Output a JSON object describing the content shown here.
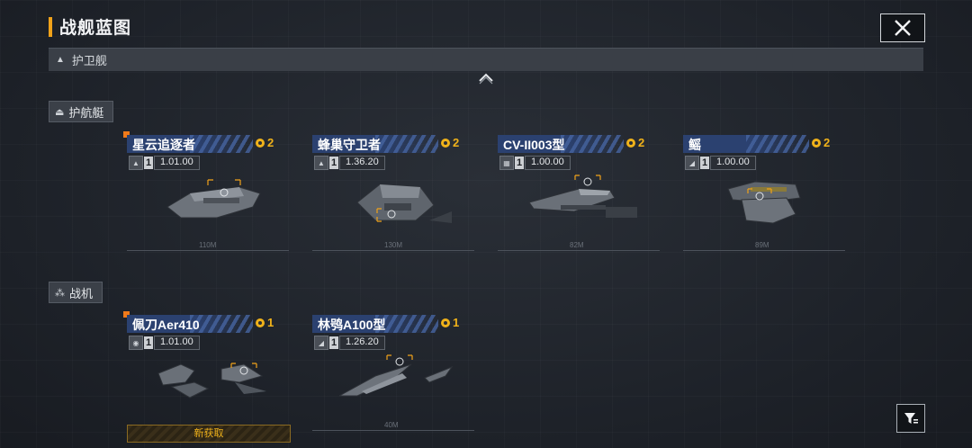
{
  "header": {
    "title": "战舰蓝图"
  },
  "category": {
    "label": "护卫舰"
  },
  "sections": [
    {
      "label": "护航艇"
    },
    {
      "label": "战机"
    }
  ],
  "escorts": [
    {
      "name": "星云追逐者",
      "count": "2",
      "level": "1",
      "value": "1.01.00",
      "dim": "110M"
    },
    {
      "name": "蜂巢守卫者",
      "count": "2",
      "level": "1",
      "value": "1.36.20",
      "dim": "130M"
    },
    {
      "name": "CV-II003型",
      "count": "2",
      "level": "1",
      "value": "1.00.00",
      "dim": "82M"
    },
    {
      "name": "鳐",
      "count": "2",
      "level": "1",
      "value": "1.00.00",
      "dim": "89M"
    }
  ],
  "fighters": [
    {
      "name": "佩刀Aer410",
      "count": "1",
      "level": "1",
      "value": "1.01.00",
      "status": "新获取"
    },
    {
      "name": "林鸮A100型",
      "count": "1",
      "level": "1",
      "value": "1.26.20",
      "dim": "40M"
    }
  ],
  "colors": {
    "accent": "#f0a21a",
    "name_bar": "#2b4170",
    "new_corner": "#f07a1a"
  }
}
